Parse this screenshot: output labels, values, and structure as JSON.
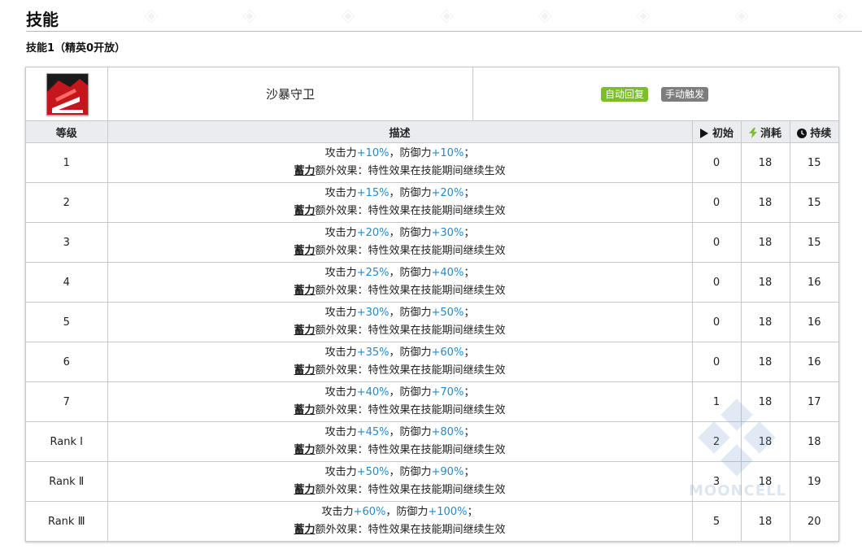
{
  "section": {
    "title": "技能",
    "subtitle": "技能1（精英0开放）"
  },
  "skill": {
    "name": "沙暴守卫",
    "tags": [
      "自动回复",
      "手动触发"
    ],
    "icon": "skill-icon-red-abstract"
  },
  "table": {
    "headers": {
      "level": "等级",
      "desc": "描述",
      "initial": "初始",
      "cost": "消耗",
      "duration": "持续"
    },
    "rows": [
      {
        "level": "1",
        "atk": "+10%",
        "def": "+10%",
        "initial": "0",
        "cost": "18",
        "duration": "15"
      },
      {
        "level": "2",
        "atk": "+15%",
        "def": "+20%",
        "initial": "0",
        "cost": "18",
        "duration": "15"
      },
      {
        "level": "3",
        "atk": "+20%",
        "def": "+30%",
        "initial": "0",
        "cost": "18",
        "duration": "15"
      },
      {
        "level": "4",
        "atk": "+25%",
        "def": "+40%",
        "initial": "0",
        "cost": "18",
        "duration": "16"
      },
      {
        "level": "5",
        "atk": "+30%",
        "def": "+50%",
        "initial": "0",
        "cost": "18",
        "duration": "16"
      },
      {
        "level": "6",
        "atk": "+35%",
        "def": "+60%",
        "initial": "0",
        "cost": "18",
        "duration": "16"
      },
      {
        "level": "7",
        "atk": "+40%",
        "def": "+70%",
        "initial": "1",
        "cost": "18",
        "duration": "17"
      },
      {
        "level": "Rank Ⅰ",
        "atk": "+45%",
        "def": "+80%",
        "initial": "2",
        "cost": "18",
        "duration": "18"
      },
      {
        "level": "Rank Ⅱ",
        "atk": "+50%",
        "def": "+90%",
        "initial": "3",
        "cost": "18",
        "duration": "19"
      },
      {
        "level": "Rank Ⅲ",
        "atk": "+60%",
        "def": "+100%",
        "initial": "5",
        "cost": "18",
        "duration": "20"
      }
    ],
    "desc_texts": {
      "atk_label": "攻击力",
      "sep": "，",
      "def_label": "防御力",
      "end": "；",
      "keyword": "蓄力",
      "extra": "额外效果：特性效果在技能期间继续生效"
    }
  },
  "watermark": {
    "text": "MOONCELL"
  },
  "colors": {
    "green_tag": "#7cbe2a",
    "gray_tag": "#7d7d7d",
    "value_blue": "#1f8ad2",
    "header_bg": "#eaecf0"
  }
}
